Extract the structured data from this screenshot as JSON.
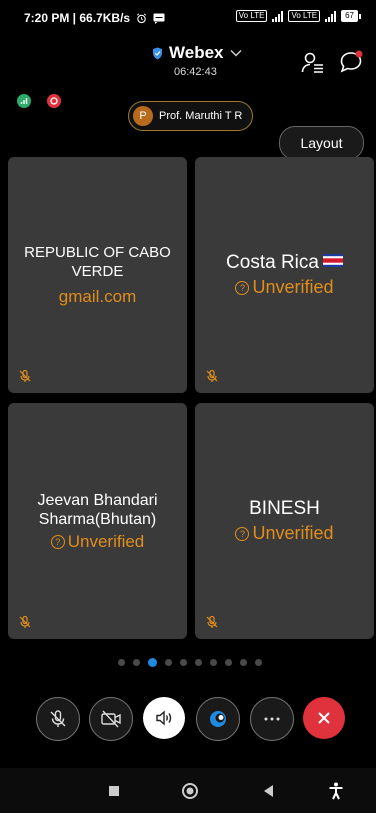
{
  "status_bar": {
    "time_speed": "7:20 PM | 66.7KB/s",
    "battery": "67",
    "volte_1": "Vo LTE",
    "volte_2": "Vo LTE"
  },
  "header": {
    "app_title": "Webex",
    "meeting_timer": "06:42:43"
  },
  "host": {
    "avatar_initial": "P",
    "name": "Prof. Maruthi T R"
  },
  "layout_button": "Layout",
  "tiles": [
    {
      "name": "REPUBLIC OF CABO VERDE",
      "sub": "gmail.com"
    },
    {
      "name": "Costa Rica",
      "sub": "Unverified"
    },
    {
      "name": "Jeevan Bhandari Sharma(Bhutan)",
      "sub": "Unverified"
    },
    {
      "name": "BINESH",
      "sub": "Unverified"
    }
  ],
  "pager": {
    "current_page": 3,
    "total_pages": 10
  },
  "colors": {
    "accent_blue": "#1e8be3",
    "unverified_orange": "#e08d1c",
    "end_call_red": "#e0323c",
    "tile_bg": "#3a3a3a"
  },
  "controls": [
    "mute-icon",
    "video-off-icon",
    "speaker-icon",
    "share-icon",
    "more-icon",
    "end-call-icon"
  ]
}
